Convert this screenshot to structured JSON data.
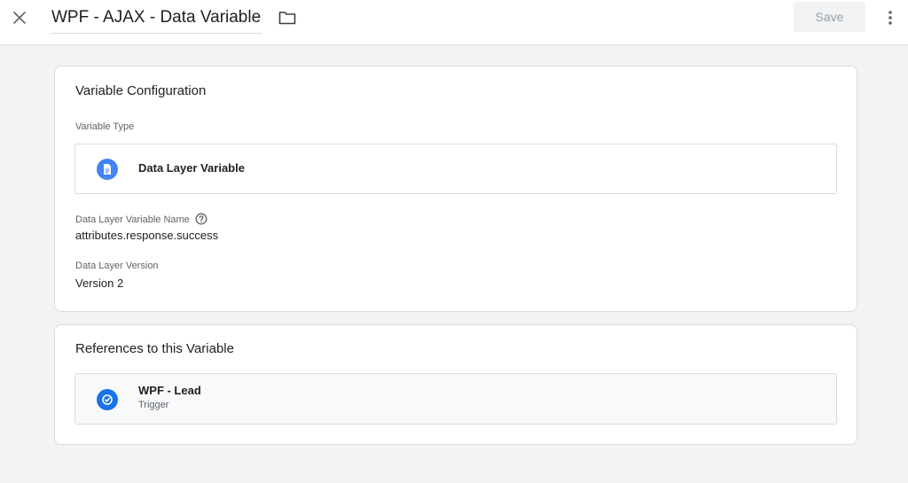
{
  "header": {
    "title": "WPF - AJAX - Data Variable",
    "save_label": "Save",
    "close_icon": "close-icon",
    "folder_icon": "folder-icon",
    "more_icon": "more-vert-icon"
  },
  "config": {
    "title": "Variable Configuration",
    "variable_type_label": "Variable Type",
    "variable_type_value": "Data Layer Variable",
    "variable_type_icon": "document-icon",
    "name_label": "Data Layer Variable Name",
    "name_help_icon": "help-icon",
    "name_value": "attributes.response.success",
    "version_label": "Data Layer Version",
    "version_value": "Version 2"
  },
  "references": {
    "title": "References to this Variable",
    "items": [
      {
        "name": "WPF - Lead",
        "kind": "Trigger",
        "icon": "trigger-icon"
      }
    ]
  },
  "colors": {
    "accent": "#1a73e8",
    "background": "#f1f3f4",
    "border": "#dadce0",
    "disabled_text": "#9aa0a6"
  }
}
